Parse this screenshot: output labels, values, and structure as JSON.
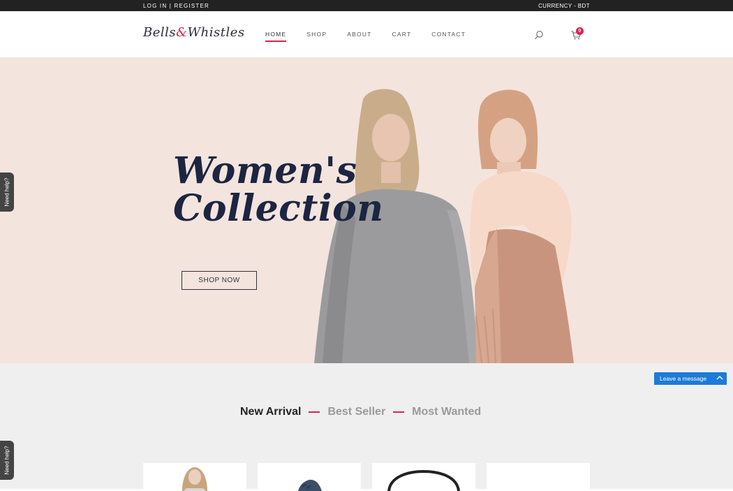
{
  "topbar": {
    "login": "LOG IN",
    "separator": "|",
    "register": "REGISTER",
    "currency": "CURRENCY - BDT"
  },
  "brand": {
    "part1": "Bells",
    "amp": "&",
    "part2": "Whistles",
    "accent_color": "#e0204f"
  },
  "nav": {
    "items": [
      "HOME",
      "SHOP",
      "ABOUT",
      "CART",
      "CONTACT"
    ],
    "active": "HOME"
  },
  "cart": {
    "count": "0"
  },
  "icons": {
    "search": "search-icon",
    "cart": "cart-icon"
  },
  "hero": {
    "title_line1": "Women's",
    "title_line2": "Collection",
    "cta": "SHOP NOW",
    "background": "#f4e4de",
    "title_color": "#1c2541"
  },
  "help": {
    "label": "Need help?"
  },
  "chat": {
    "label": "Leave a message",
    "color": "#1e7ad8"
  },
  "product_tabs": {
    "items": [
      "New Arrival",
      "Best Seller",
      "Most Wanted"
    ],
    "active": "New Arrival"
  }
}
